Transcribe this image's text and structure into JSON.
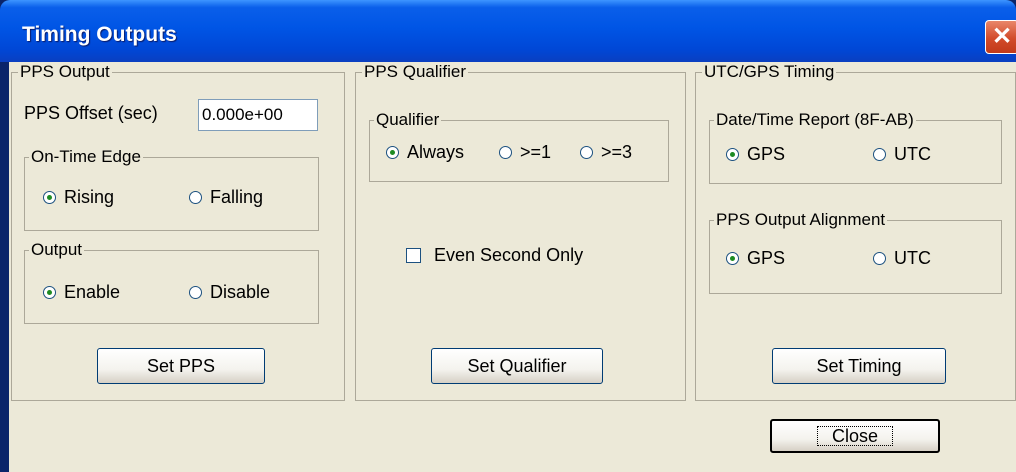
{
  "window": {
    "title": "Timing Outputs",
    "close_glyph": "✕"
  },
  "pps_output": {
    "legend": "PPS Output",
    "offset_label": "PPS Offset (sec)",
    "offset_value": "0.000e+00",
    "edge": {
      "legend": "On-Time Edge",
      "options": [
        "Rising",
        "Falling"
      ],
      "selected": "Rising"
    },
    "output": {
      "legend": "Output",
      "options": [
        "Enable",
        "Disable"
      ],
      "selected": "Enable"
    },
    "button": "Set PPS"
  },
  "pps_qualifier": {
    "legend": "PPS Qualifier",
    "qualifier": {
      "legend": "Qualifier",
      "options": [
        "Always",
        ">=1",
        ">=3"
      ],
      "selected": "Always"
    },
    "even_second": {
      "label": "Even Second Only",
      "checked": false
    },
    "button": "Set Qualifier"
  },
  "utc_gps": {
    "legend": "UTC/GPS Timing",
    "report": {
      "legend": "Date/Time Report (8F-AB)",
      "options": [
        "GPS",
        "UTC"
      ],
      "selected": "GPS"
    },
    "alignment": {
      "legend": "PPS Output Alignment",
      "options": [
        "GPS",
        "UTC"
      ],
      "selected": "GPS"
    },
    "button": "Set Timing"
  },
  "close_button": "Close"
}
